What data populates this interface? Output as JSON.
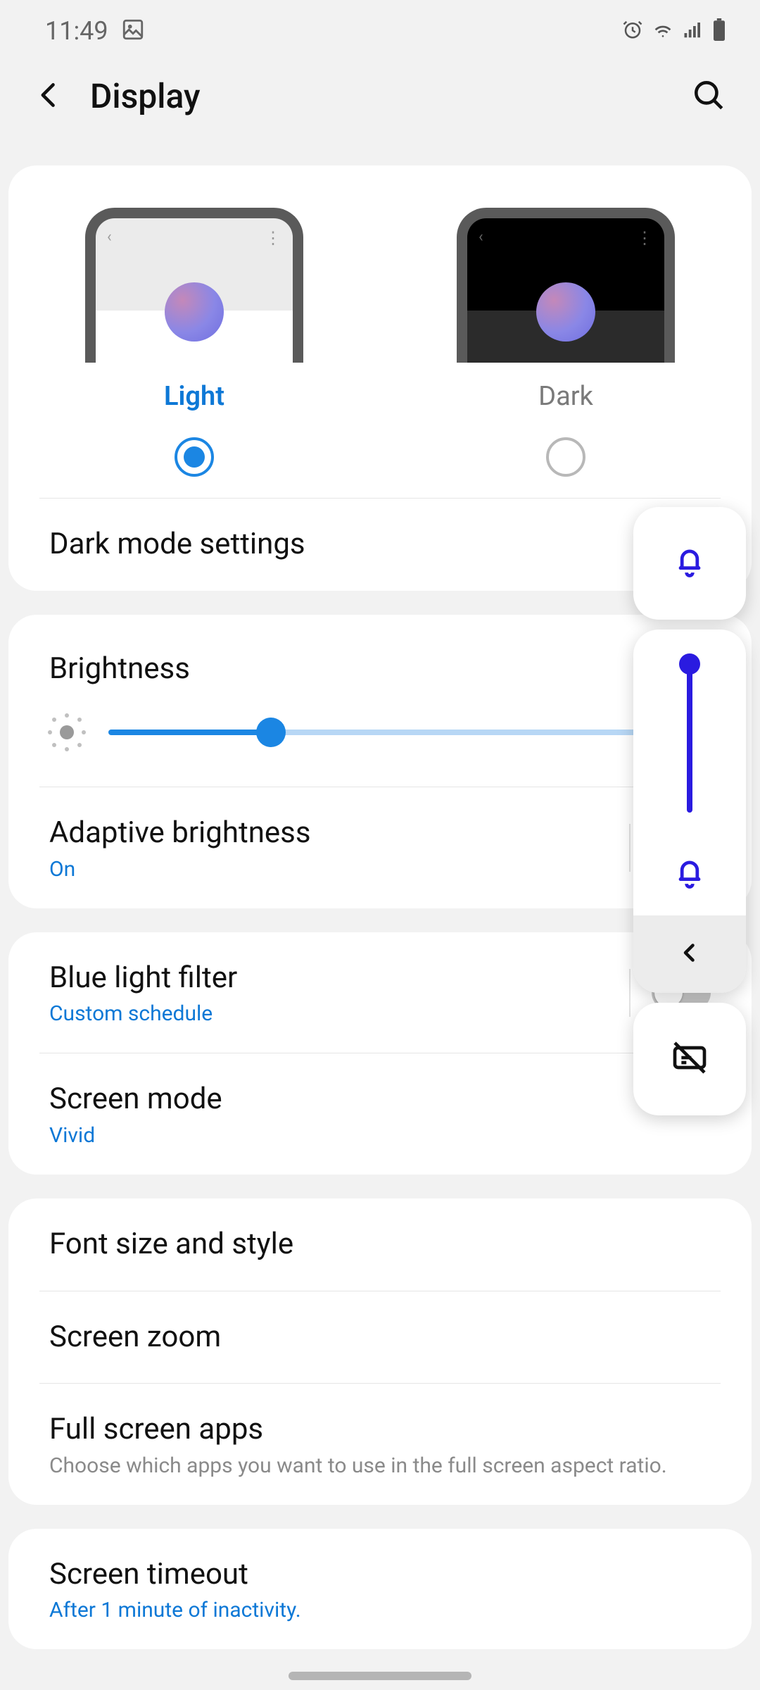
{
  "status": {
    "time": "11:49"
  },
  "header": {
    "title": "Display"
  },
  "theme": {
    "light_label": "Light",
    "dark_label": "Dark",
    "selected": "light"
  },
  "dark_mode_settings": {
    "title": "Dark mode settings"
  },
  "brightness": {
    "title": "Brightness",
    "percent": 27
  },
  "adaptive": {
    "title": "Adaptive brightness",
    "value": "On",
    "toggle": true
  },
  "blue_light": {
    "title": "Blue light filter",
    "value": "Custom schedule",
    "toggle": false
  },
  "screen_mode": {
    "title": "Screen mode",
    "value": "Vivid"
  },
  "font": {
    "title": "Font size and style"
  },
  "zoom": {
    "title": "Screen zoom"
  },
  "fullscreen": {
    "title": "Full screen apps",
    "desc": "Choose which apps you want to use in the full screen aspect ratio."
  },
  "timeout": {
    "title": "Screen timeout",
    "value": "After 1 minute of inactivity."
  },
  "volume_overlay": {
    "level_percent": 100
  }
}
